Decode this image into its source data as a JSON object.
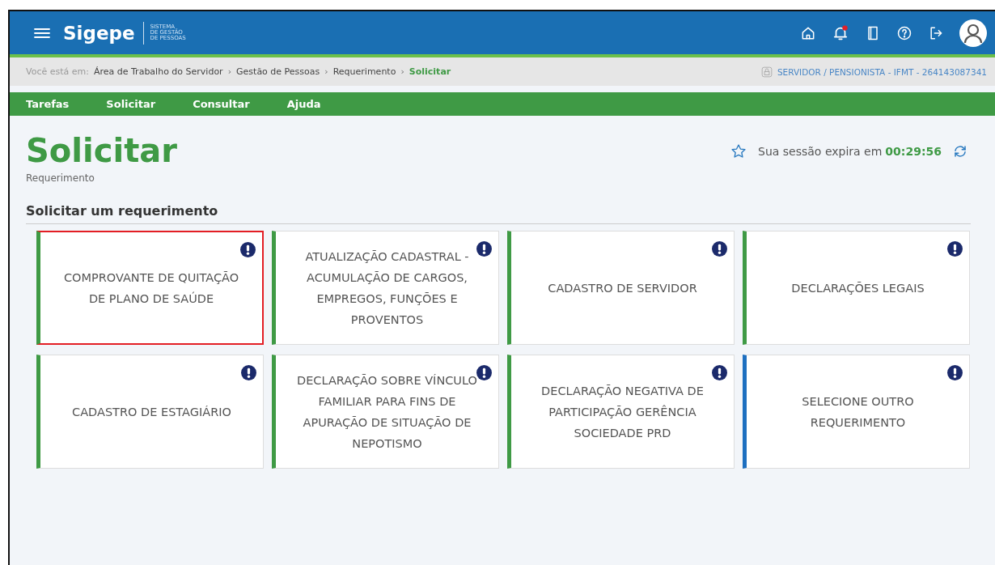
{
  "header": {
    "app_name": "Sigepe",
    "app_subtitle": [
      "SISTEMA",
      "DE GESTÃO",
      "DE PESSOAS"
    ],
    "notification_dot": true
  },
  "breadcrumb": {
    "prefix": "Você está em:",
    "separator": "›",
    "items": [
      "Área de Trabalho do Servidor",
      "Gestão de Pessoas",
      "Requerimento",
      "Solicitar"
    ],
    "profile": "SERVIDOR / PENSIONISTA - IFMT - 264143087341"
  },
  "nav": [
    "Tarefas",
    "Solicitar",
    "Consultar",
    "Ajuda"
  ],
  "page": {
    "title": "Solicitar",
    "subtitle": "Requerimento",
    "session_label": "Sua sessão expira em",
    "session_time": "00:29:56"
  },
  "section_title": "Solicitar um requerimento",
  "cards": [
    {
      "label": "COMPROVANTE DE QUITAÇÃO DE PLANO DE SAÚDE",
      "color": "#3f9a45",
      "selected": true
    },
    {
      "label": "ATUALIZAÇÃO CADASTRAL - ACUMULAÇÃO DE CARGOS, EMPREGOS, FUNÇÕES E PROVENTOS",
      "color": "#3f9a45",
      "selected": false
    },
    {
      "label": "CADASTRO DE SERVIDOR",
      "color": "#3f9a45",
      "selected": false
    },
    {
      "label": "DECLARAÇÕES LEGAIS",
      "color": "#3f9a45",
      "selected": false
    },
    {
      "label": "CADASTRO DE ESTAGIÁRIO",
      "color": "#3f9a45",
      "selected": false
    },
    {
      "label": "DECLARAÇÃO SOBRE VÍNCULO FAMILIAR PARA FINS DE APURAÇÃO DE SITUAÇÃO DE NEPOTISMO",
      "color": "#3f9a45",
      "selected": false
    },
    {
      "label": "DECLARAÇÃO NEGATIVA DE PARTICIPAÇÃO GERÊNCIA SOCIEDADE PRD",
      "color": "#3f9a45",
      "selected": false
    },
    {
      "label": "SELECIONE OUTRO REQUERIMENTO",
      "color": "#1d6fc0",
      "selected": false
    }
  ]
}
